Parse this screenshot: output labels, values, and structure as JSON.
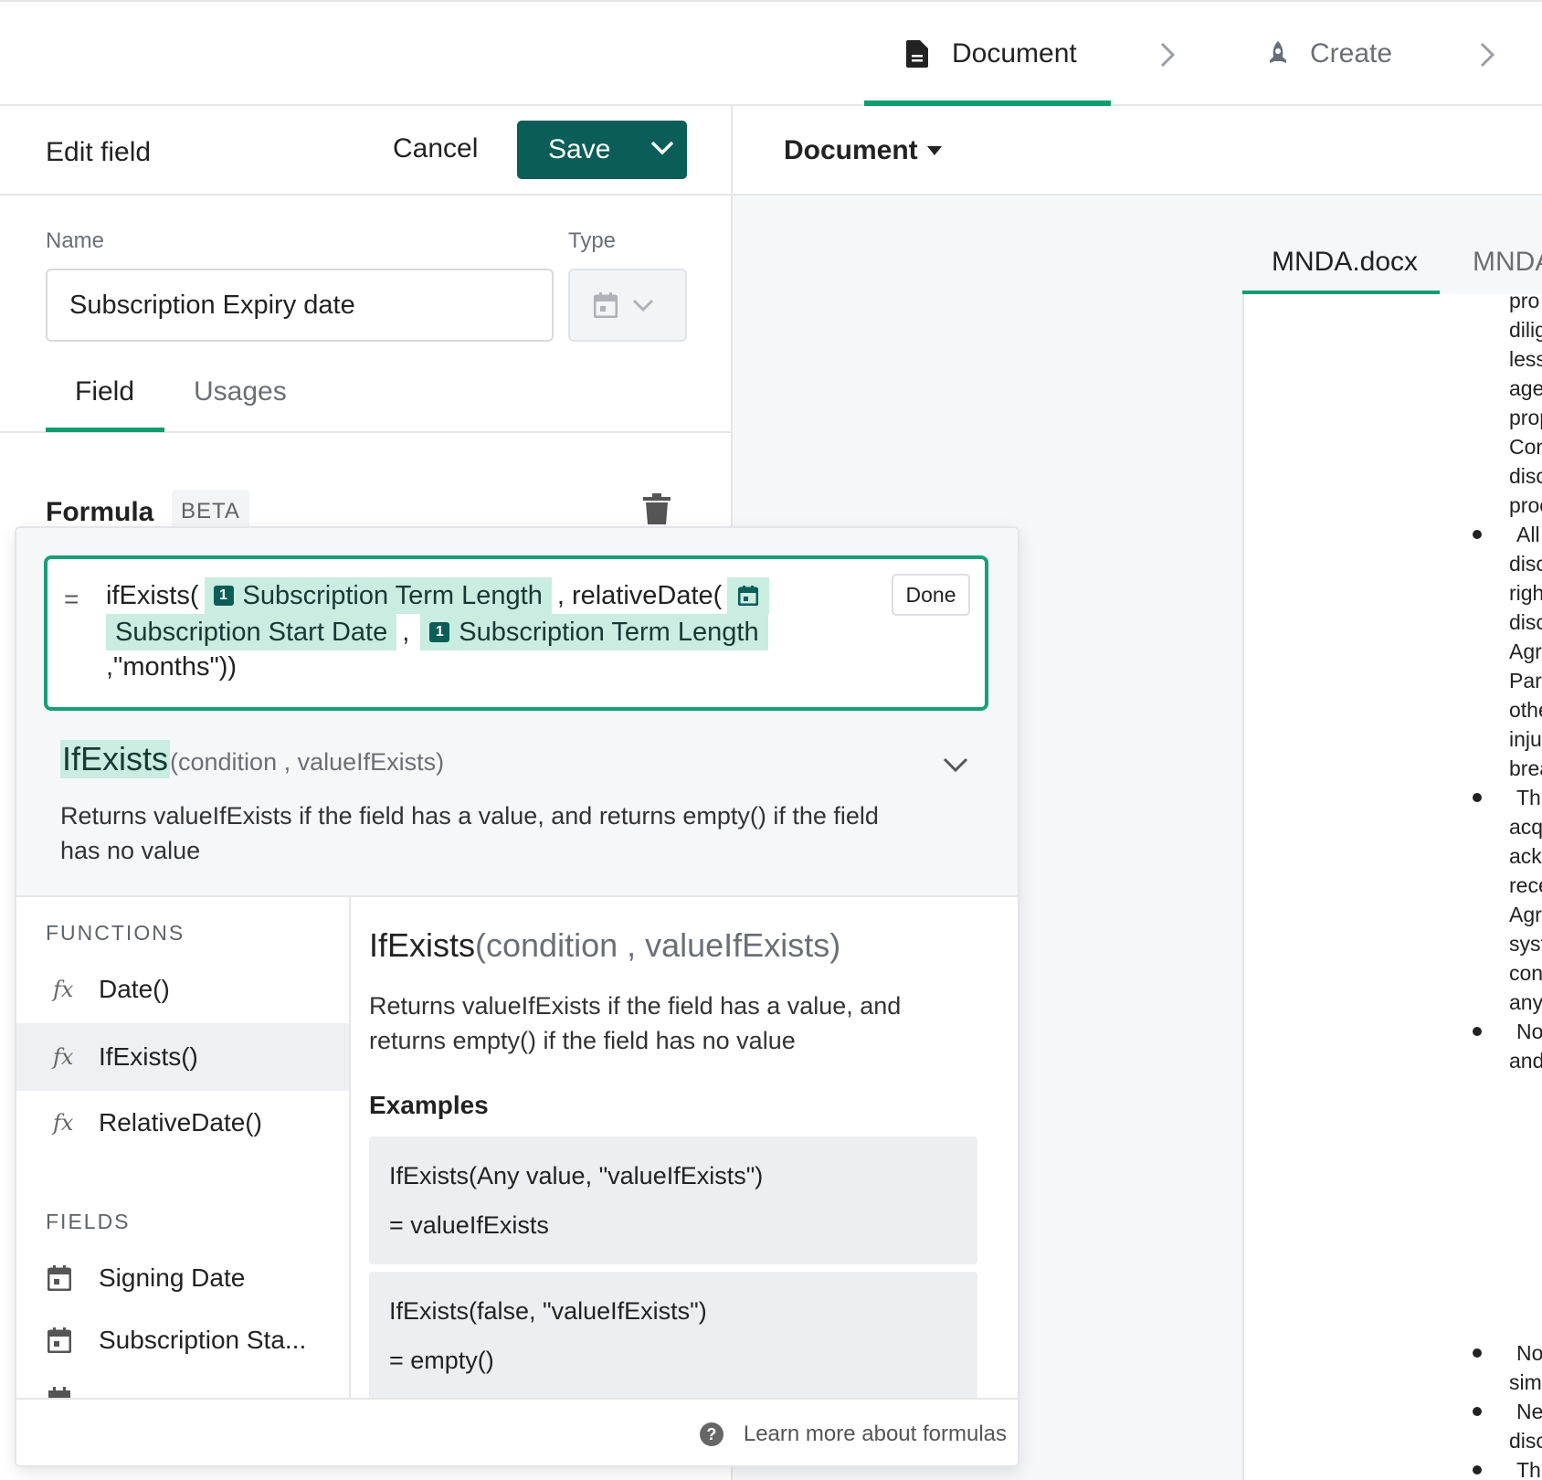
{
  "nav": {
    "steps": [
      {
        "label": "Document",
        "active": true
      },
      {
        "label": "Create",
        "active": false
      }
    ]
  },
  "edit_panel": {
    "title": "Edit field",
    "cancel_label": "Cancel",
    "save_label": "Save",
    "name_label": "Name",
    "name_value": "Subscription Expiry date",
    "type_label": "Type",
    "type_icon": "calendar-icon",
    "tabs": [
      {
        "label": "Field",
        "active": true
      },
      {
        "label": "Usages",
        "active": false
      }
    ],
    "formula_label": "Formula",
    "beta_badge": "BETA"
  },
  "formula": {
    "equals": "=",
    "tokens": {
      "fn_ifexists": "ifExists(",
      "chip_term_length": "Subscription Term Length",
      "sep_relative": ", relativeDate(",
      "chip_start_date": "Subscription Start Date",
      "comma": ",",
      "chip_term_length_2": "Subscription Term Length",
      "tail": ",\"months\"))",
      "num_badge": "1"
    },
    "done_label": "Done",
    "accent_color": "#16a077",
    "chip_color": "#c9ede1"
  },
  "signature": {
    "fn_name": "IfExists",
    "params": "(condition , valueIfExists)",
    "description": "Returns valueIfExists if the field has a value, and returns empty() if the field has no value"
  },
  "functions": {
    "heading": "FUNCTIONS",
    "items": [
      {
        "label": "Date()",
        "active": false
      },
      {
        "label": "IfExists()",
        "active": true
      },
      {
        "label": "RelativeDate()",
        "active": false
      }
    ]
  },
  "fields": {
    "heading": "FIELDS",
    "items": [
      {
        "label": "Signing Date"
      },
      {
        "label": "Subscription Sta..."
      }
    ]
  },
  "doc_pane": {
    "title_fn": "IfExists",
    "title_params": "(condition , valueIfExists)",
    "description": "Returns valueIfExists if the field has a value, and returns empty() if the field has no value",
    "examples_heading": "Examples",
    "examples": [
      {
        "code": "IfExists(Any value, \"valueIfExists\")",
        "result": "= valueIfExists"
      },
      {
        "code": "IfExists(false, \"valueIfExists\")",
        "result": "= empty()"
      }
    ]
  },
  "footer": {
    "learn_more": "Learn more about formulas",
    "help_glyph": "?"
  },
  "right": {
    "document_dropdown": "Document",
    "doc_tabs": [
      {
        "label": "MNDA.docx",
        "active": true
      },
      {
        "label": "MNDA",
        "active": false
      }
    ],
    "page_fragments": [
      "pro",
      "dilig",
      "less",
      "age",
      "prop",
      "Con",
      "disc",
      "proc",
      "All",
      "disc",
      "righ",
      "disc",
      "Agr",
      "Par",
      "othe",
      "inju",
      "brea",
      "Th",
      "acq",
      "ack",
      "rece",
      "Agr",
      "syst",
      "con",
      "any",
      "No",
      "and",
      "No",
      "sim",
      "Ne",
      "disc",
      "Th"
    ]
  }
}
